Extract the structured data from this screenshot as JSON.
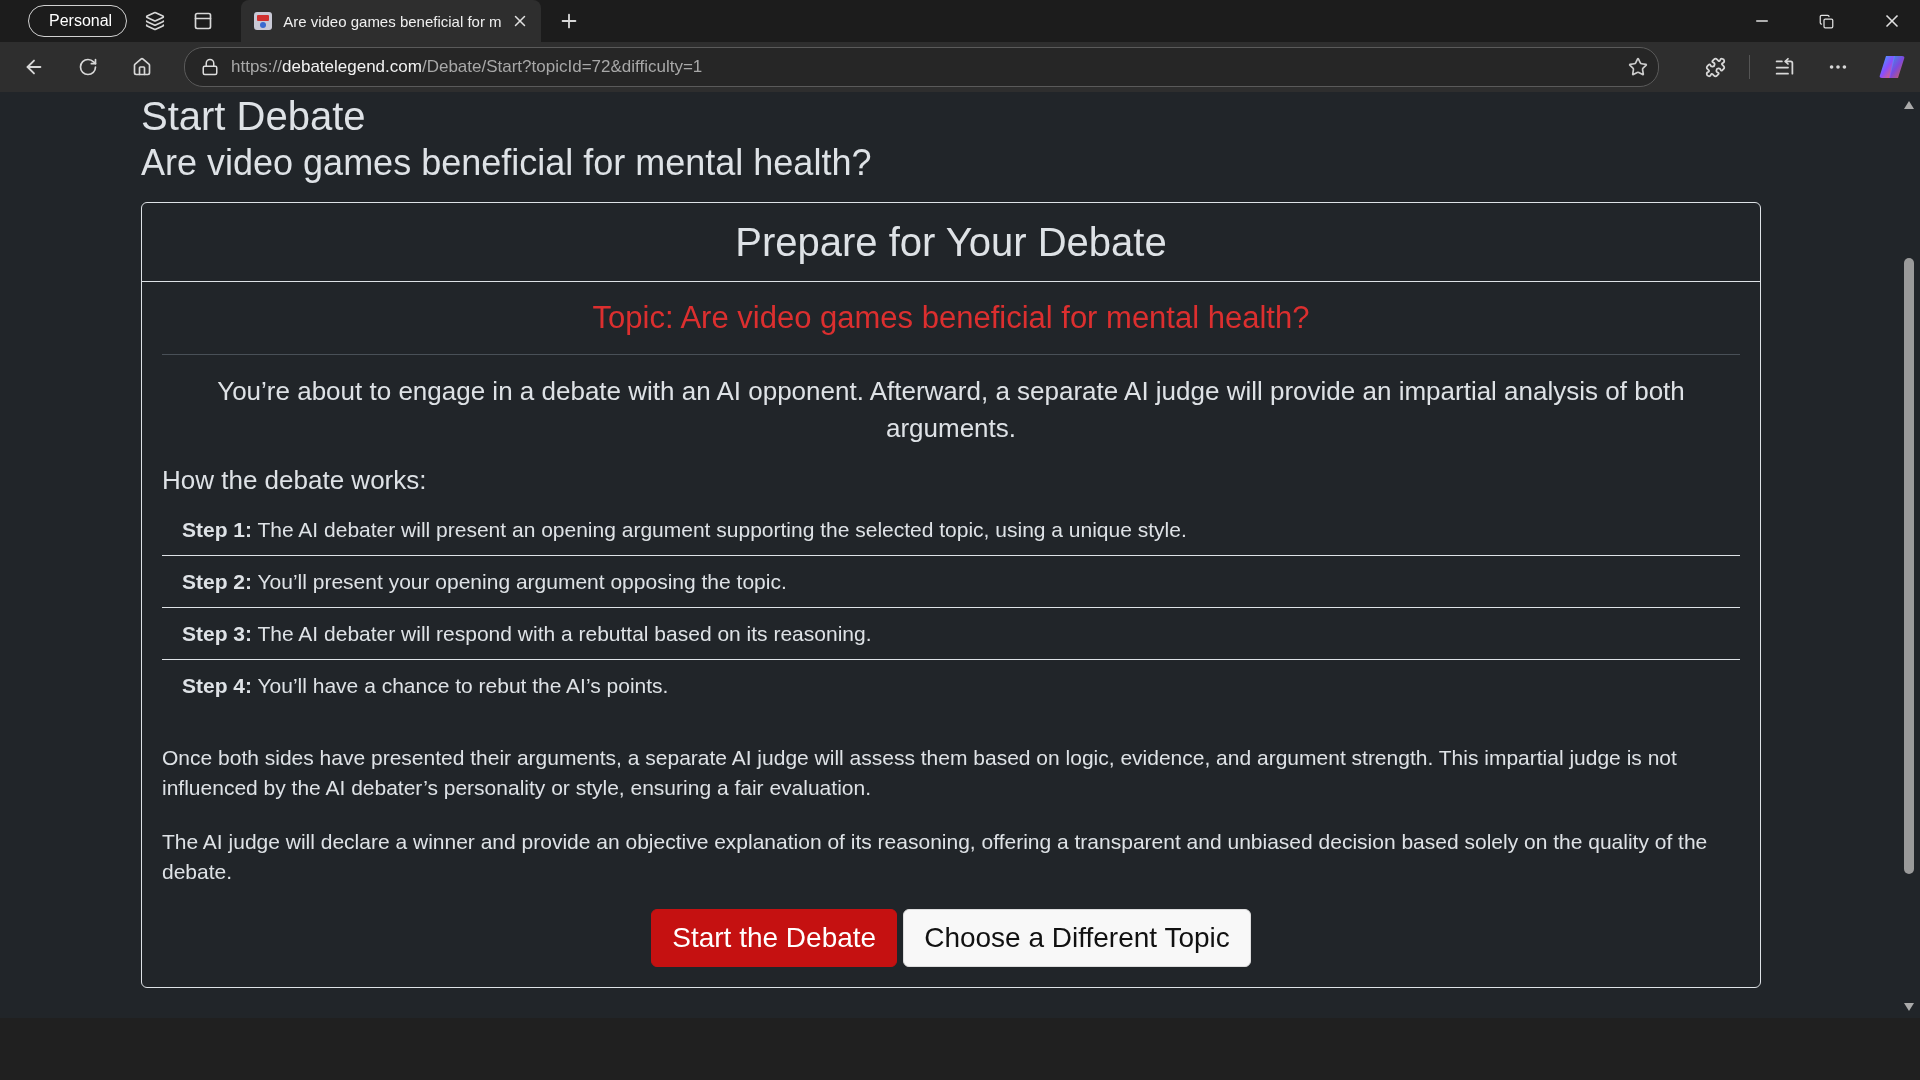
{
  "browser": {
    "profile": "Personal",
    "tabs": [
      {
        "title": "Are video games beneficial for m",
        "selected": true
      }
    ],
    "url": {
      "scheme": "https://",
      "host": "debatelegend.com",
      "path": "/Debate/Start?topicId=72&difficulty=1"
    }
  },
  "page": {
    "heading": "Start Debate",
    "subtitle": "Are video games beneficial for mental health?",
    "card": {
      "title": "Prepare for Your Debate",
      "topic": "Topic: Are video games beneficial for mental health?",
      "intro": "You’re about to engage in a debate with an AI opponent. Afterward, a separate AI judge will provide an impartial analysis of both arguments.",
      "steps_heading": "How the debate works:",
      "steps": [
        {
          "label": "Step 1:",
          "text": "The AI debater will present an opening argument supporting the selected topic, using a unique style."
        },
        {
          "label": "Step 2:",
          "text": "You’ll present your opening argument opposing the topic."
        },
        {
          "label": "Step 3:",
          "text": "The AI debater will respond with a rebuttal based on its reasoning."
        },
        {
          "label": "Step 4:",
          "text": "You’ll have a chance to rebut the AI’s points."
        }
      ],
      "paragraphs": [
        "Once both sides have presented their arguments, a separate AI judge will assess them based on logic, evidence, and argument strength. This impartial judge is not influenced by the AI debater’s personality or style, ensuring a fair evaluation.",
        "The AI judge will declare a winner and provide an objective explanation of its reasoning, offering a transparent and unbiased decision based solely on the quality of the debate."
      ],
      "buttons": [
        {
          "label": "Start the Debate",
          "kind": "primary"
        },
        {
          "label": "Choose a Different Topic",
          "kind": "secondary"
        }
      ]
    }
  }
}
